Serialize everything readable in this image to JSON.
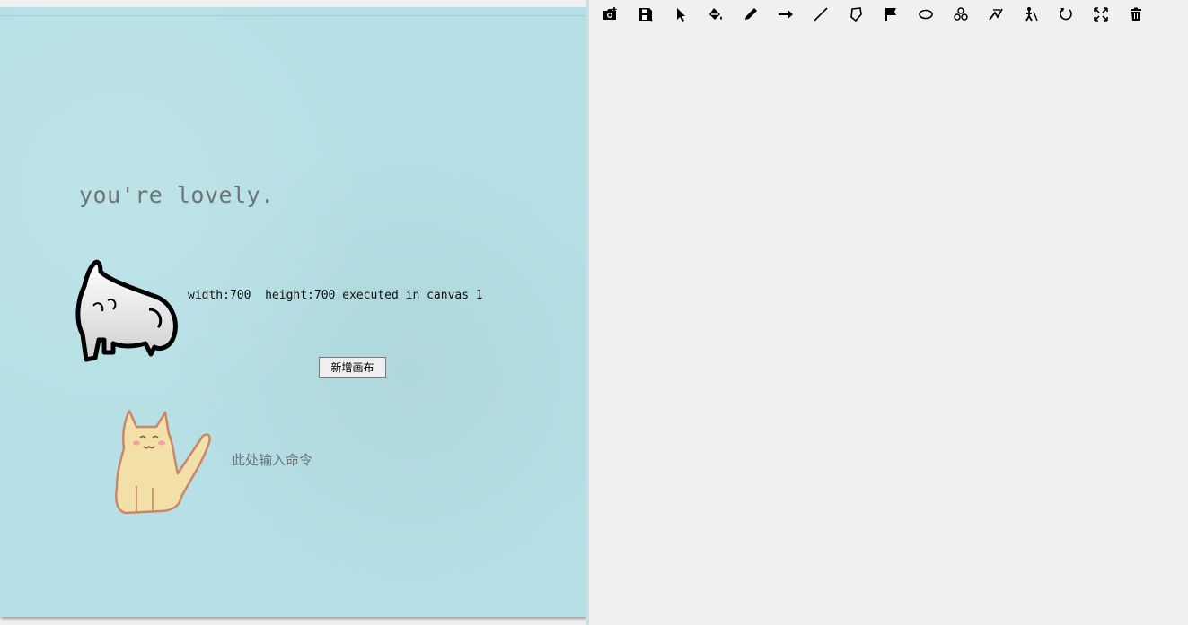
{
  "left_panel": {
    "background_color": "#b6e0e5",
    "header_text": "you're lovely.",
    "status_text": "width:700  height:700 executed in canvas 1",
    "add_canvas_button": "新增画布",
    "command_input": {
      "placeholder": "此处输入命令",
      "value": ""
    },
    "images": [
      "ghost-cat-illustration",
      "sitting-cat-illustration"
    ]
  },
  "toolbar": {
    "tools": [
      {
        "name": "open-image-icon"
      },
      {
        "name": "save-icon"
      },
      {
        "name": "cursor-icon"
      },
      {
        "name": "fill-bucket-icon"
      },
      {
        "name": "pencil-icon"
      },
      {
        "name": "arrow-right-icon"
      },
      {
        "name": "line-icon"
      },
      {
        "name": "polygon-icon"
      },
      {
        "name": "flag-icon"
      },
      {
        "name": "ellipse-icon"
      },
      {
        "name": "shapes-icon"
      },
      {
        "name": "curve-icon"
      },
      {
        "name": "figure-icon"
      },
      {
        "name": "rotate-icon"
      },
      {
        "name": "fullscreen-icon"
      },
      {
        "name": "trash-icon"
      }
    ]
  }
}
